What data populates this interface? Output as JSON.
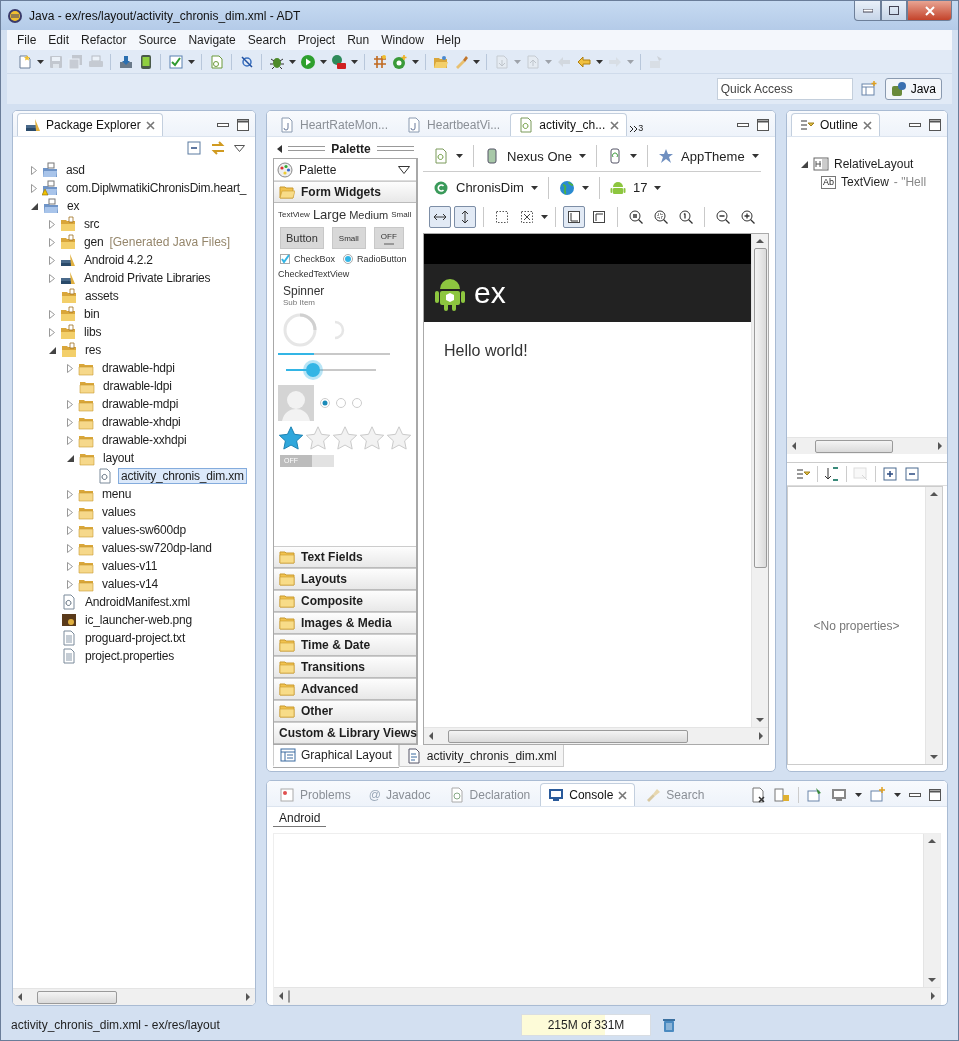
{
  "window": {
    "title": "Java - ex/res/layout/activity_chronis_dim.xml - ADT"
  },
  "menu": [
    "File",
    "Edit",
    "Refactor",
    "Source",
    "Navigate",
    "Search",
    "Project",
    "Run",
    "Window",
    "Help"
  ],
  "toolbar": [
    {
      "items": [
        {
          "kind": "new",
          "dropdown": true,
          "disabled": false
        },
        {
          "kind": "save",
          "dropdown": false,
          "disabled": true
        },
        {
          "kind": "save-all",
          "dropdown": false,
          "disabled": true
        },
        {
          "kind": "print",
          "dropdown": false,
          "disabled": true
        }
      ]
    },
    {
      "items": [
        {
          "kind": "sdk",
          "dropdown": false,
          "disabled": false
        },
        {
          "kind": "avd",
          "dropdown": false,
          "disabled": false
        }
      ]
    },
    {
      "items": [
        {
          "kind": "check",
          "dropdown": true,
          "disabled": false
        }
      ]
    },
    {
      "items": [
        {
          "kind": "new-xml",
          "dropdown": false,
          "disabled": false
        }
      ]
    },
    {
      "items": [
        {
          "kind": "link",
          "dropdown": false,
          "disabled": false
        }
      ]
    },
    {
      "items": [
        {
          "kind": "bug",
          "dropdown": true,
          "disabled": false
        },
        {
          "kind": "run",
          "dropdown": true,
          "disabled": false
        },
        {
          "kind": "run-ext",
          "dropdown": true,
          "disabled": false
        }
      ]
    },
    {
      "items": [
        {
          "kind": "grid",
          "dropdown": false,
          "disabled": false
        },
        {
          "kind": "new-class",
          "dropdown": true,
          "disabled": false
        }
      ]
    },
    {
      "items": [
        {
          "kind": "folder-open",
          "dropdown": false,
          "disabled": false
        },
        {
          "kind": "brush",
          "dropdown": true,
          "disabled": false
        }
      ]
    },
    {
      "items": [
        {
          "kind": "annot-next",
          "dropdown": true,
          "disabled": true
        },
        {
          "kind": "annot-prev",
          "dropdown": true,
          "disabled": true
        },
        {
          "kind": "back-edit",
          "dropdown": false,
          "disabled": true
        },
        {
          "kind": "back",
          "dropdown": true,
          "disabled": false
        },
        {
          "kind": "forward",
          "dropdown": true,
          "disabled": true
        }
      ]
    },
    {
      "items": [
        {
          "kind": "pin",
          "dropdown": false,
          "disabled": true
        }
      ]
    }
  ],
  "quick_access": {
    "placeholder": "Quick Access"
  },
  "perspectives": [
    {
      "label": "Java",
      "selected": true
    }
  ],
  "package_explorer": {
    "title": "Package Explorer",
    "tree": [
      {
        "label": "asd",
        "kind": "project",
        "expandable": true,
        "expanded": false,
        "selected": false
      },
      {
        "label": "com.DiplwmatikiChronisDim.heart_",
        "kind": "project-warn",
        "expandable": true,
        "expanded": false,
        "selected": false
      },
      {
        "label": "ex",
        "kind": "project",
        "expandable": true,
        "expanded": true,
        "selected": false,
        "children": [
          {
            "label": "src",
            "kind": "package-folder",
            "expandable": true,
            "expanded": false,
            "selected": false
          },
          {
            "label": "gen",
            "note": "[Generated Java Files]",
            "kind": "package-folder",
            "expandable": true,
            "expanded": false,
            "selected": false
          },
          {
            "label": "Android 4.2.2",
            "kind": "library",
            "expandable": true,
            "expanded": false,
            "selected": false
          },
          {
            "label": "Android Private Libraries",
            "kind": "library",
            "expandable": true,
            "expanded": false,
            "selected": false
          },
          {
            "label": "assets",
            "kind": "package-folder",
            "expandable": false,
            "selected": false
          },
          {
            "label": "bin",
            "kind": "package-folder",
            "expandable": true,
            "expanded": false,
            "selected": false
          },
          {
            "label": "libs",
            "kind": "package-folder",
            "expandable": true,
            "expanded": false,
            "selected": false
          },
          {
            "label": "res",
            "kind": "package-folder",
            "expandable": true,
            "expanded": true,
            "selected": false,
            "children": [
              {
                "label": "drawable-hdpi",
                "kind": "folder",
                "expandable": true,
                "expanded": false,
                "selected": false
              },
              {
                "label": "drawable-ldpi",
                "kind": "folder",
                "expandable": false,
                "selected": false
              },
              {
                "label": "drawable-mdpi",
                "kind": "folder",
                "expandable": true,
                "expanded": false,
                "selected": false
              },
              {
                "label": "drawable-xhdpi",
                "kind": "folder",
                "expandable": true,
                "expanded": false,
                "selected": false
              },
              {
                "label": "drawable-xxhdpi",
                "kind": "folder",
                "expandable": true,
                "expanded": false,
                "selected": false
              },
              {
                "label": "layout",
                "kind": "folder",
                "expandable": true,
                "expanded": true,
                "selected": false,
                "children": [
                  {
                    "label": "activity_chronis_dim.xm",
                    "kind": "xml",
                    "expandable": false,
                    "selected": true
                  }
                ]
              },
              {
                "label": "menu",
                "kind": "folder",
                "expandable": true,
                "expanded": false,
                "selected": false
              },
              {
                "label": "values",
                "kind": "folder",
                "expandable": true,
                "expanded": false,
                "selected": false
              },
              {
                "label": "values-sw600dp",
                "kind": "folder",
                "expandable": true,
                "expanded": false,
                "selected": false
              },
              {
                "label": "values-sw720dp-land",
                "kind": "folder",
                "expandable": true,
                "expanded": false,
                "selected": false
              },
              {
                "label": "values-v11",
                "kind": "folder",
                "expandable": true,
                "expanded": false,
                "selected": false
              },
              {
                "label": "values-v14",
                "kind": "folder",
                "expandable": true,
                "expanded": false,
                "selected": false
              }
            ]
          },
          {
            "label": "AndroidManifest.xml",
            "kind": "xml",
            "expandable": false,
            "selected": false
          },
          {
            "label": "ic_launcher-web.png",
            "kind": "image",
            "expandable": false,
            "selected": false
          },
          {
            "label": "proguard-project.txt",
            "kind": "text",
            "expandable": false,
            "selected": false
          },
          {
            "label": "project.properties",
            "kind": "text",
            "expandable": false,
            "selected": false
          }
        ]
      }
    ]
  },
  "editor": {
    "tabs": [
      {
        "label": "HeartRateMon...",
        "kind": "java",
        "selected": false
      },
      {
        "label": "HeartbeatVi...",
        "kind": "java",
        "selected": false
      },
      {
        "label": "activity_ch...",
        "kind": "xml",
        "selected": true
      }
    ],
    "overflow_count": "3",
    "palette": {
      "title": "Palette",
      "selector": "Palette",
      "previews": {
        "text_sizes": [
          {
            "label": "TextView",
            "kind": "tiny"
          },
          {
            "label": "Large",
            "kind": "large"
          },
          {
            "label": "Medium",
            "kind": "medium"
          },
          {
            "label": "Small",
            "kind": "small"
          }
        ],
        "buttons": [
          {
            "label": "Button",
            "kind": "normal"
          },
          {
            "label": "Small",
            "kind": "small"
          },
          {
            "label": "OFF",
            "kind": "toggle"
          }
        ],
        "checkbox": {
          "label": "CheckBox",
          "checked": true
        },
        "radio": {
          "label": "RadioButton",
          "selected": true
        },
        "checked_text": "CheckedTextView",
        "spinner": {
          "title": "Spinner",
          "subtitle": "Sub Item"
        },
        "progress": {
          "level": 0.32
        },
        "seekbar": {
          "level": 0.3
        },
        "radio_group": [
          {
            "selected": true
          },
          {
            "selected": false
          },
          {
            "selected": false
          }
        ],
        "rating": {
          "stars": 1
        },
        "switch": {
          "label": "OFF",
          "on": false
        }
      },
      "categories": [
        {
          "label": "Form Widgets",
          "kind": "folder",
          "expanded": true
        },
        {
          "label": "Text Fields",
          "kind": "folder",
          "expanded": false
        },
        {
          "label": "Layouts",
          "kind": "folder",
          "expanded": false
        },
        {
          "label": "Composite",
          "kind": "folder",
          "expanded": false
        },
        {
          "label": "Images & Media",
          "kind": "folder",
          "expanded": false
        },
        {
          "label": "Time & Date",
          "kind": "folder",
          "expanded": false
        },
        {
          "label": "Transitions",
          "kind": "folder",
          "expanded": false
        },
        {
          "label": "Advanced",
          "kind": "folder",
          "expanded": false
        },
        {
          "label": "Other",
          "kind": "folder",
          "expanded": false
        },
        {
          "label": "Custom & Library Views",
          "kind": "plain",
          "expanded": false
        }
      ]
    },
    "config_rows": [
      {
        "items": [
          {
            "kind": "layout-file",
            "dropdown": true
          },
          {
            "kind": "device",
            "label": "Nexus One",
            "dropdown": true
          },
          {
            "kind": "rotate",
            "dropdown": true
          },
          {
            "kind": "theme",
            "label": "AppTheme",
            "dropdown": true
          }
        ]
      },
      {
        "items": [
          {
            "kind": "activity",
            "label": "ChronisDim",
            "dropdown": true
          },
          {
            "kind": "locale",
            "dropdown": true
          },
          {
            "kind": "android",
            "label": "17",
            "dropdown": true
          }
        ]
      }
    ],
    "zoom_tools": [
      {
        "items": [
          {
            "kind": "fit-width",
            "pressed": true,
            "dropdown": false
          },
          {
            "kind": "fit-height",
            "pressed": true,
            "dropdown": false
          }
        ]
      },
      {
        "items": [
          {
            "kind": "select-box",
            "pressed": false,
            "dropdown": false
          },
          {
            "kind": "expand-box",
            "pressed": false,
            "dropdown": true
          }
        ]
      },
      {
        "items": [
          {
            "kind": "layout-a",
            "pressed": true,
            "dropdown": false
          },
          {
            "kind": "layout-b",
            "pressed": false,
            "dropdown": false
          }
        ]
      },
      {
        "items": [
          {
            "kind": "zoom-fit",
            "pressed": false,
            "dropdown": false
          },
          {
            "kind": "zoom-reset",
            "pressed": false,
            "dropdown": false
          },
          {
            "kind": "zoom-100",
            "pressed": false,
            "dropdown": false
          }
        ]
      },
      {
        "items": [
          {
            "kind": "zoom-out",
            "pressed": false,
            "dropdown": false
          },
          {
            "kind": "zoom-in",
            "pressed": false,
            "dropdown": false
          }
        ]
      }
    ],
    "device": {
      "app_title": "ex",
      "text": "Hello world!"
    },
    "bottom_tabs": [
      {
        "label": "Graphical Layout",
        "kind": "layout",
        "selected": true
      },
      {
        "label": "activity_chronis_dim.xml",
        "kind": "source",
        "selected": false
      }
    ]
  },
  "outline": {
    "title": "Outline",
    "tree": [
      {
        "label": "RelativeLayout",
        "kind": "relative",
        "expanded": true,
        "children": [
          {
            "label": "TextView",
            "detail": "- \"Hell",
            "badge": "Ab",
            "kind": "text-view"
          }
        ]
      }
    ],
    "properties_empty": "<No properties>"
  },
  "console": {
    "tabs": [
      {
        "label": "Problems",
        "kind": "problems",
        "selected": false
      },
      {
        "label": "Javadoc",
        "kind": "javadoc",
        "glyph": "@",
        "selected": false
      },
      {
        "label": "Declaration",
        "kind": "declaration",
        "selected": false
      },
      {
        "label": "Console",
        "kind": "console",
        "selected": true
      },
      {
        "label": "Search",
        "kind": "search",
        "selected": false
      }
    ],
    "name": "Android"
  },
  "status": {
    "text": "activity_chronis_dim.xml - ex/res/layout",
    "memory": {
      "label": "215M of 331M",
      "level": 0.65
    }
  }
}
